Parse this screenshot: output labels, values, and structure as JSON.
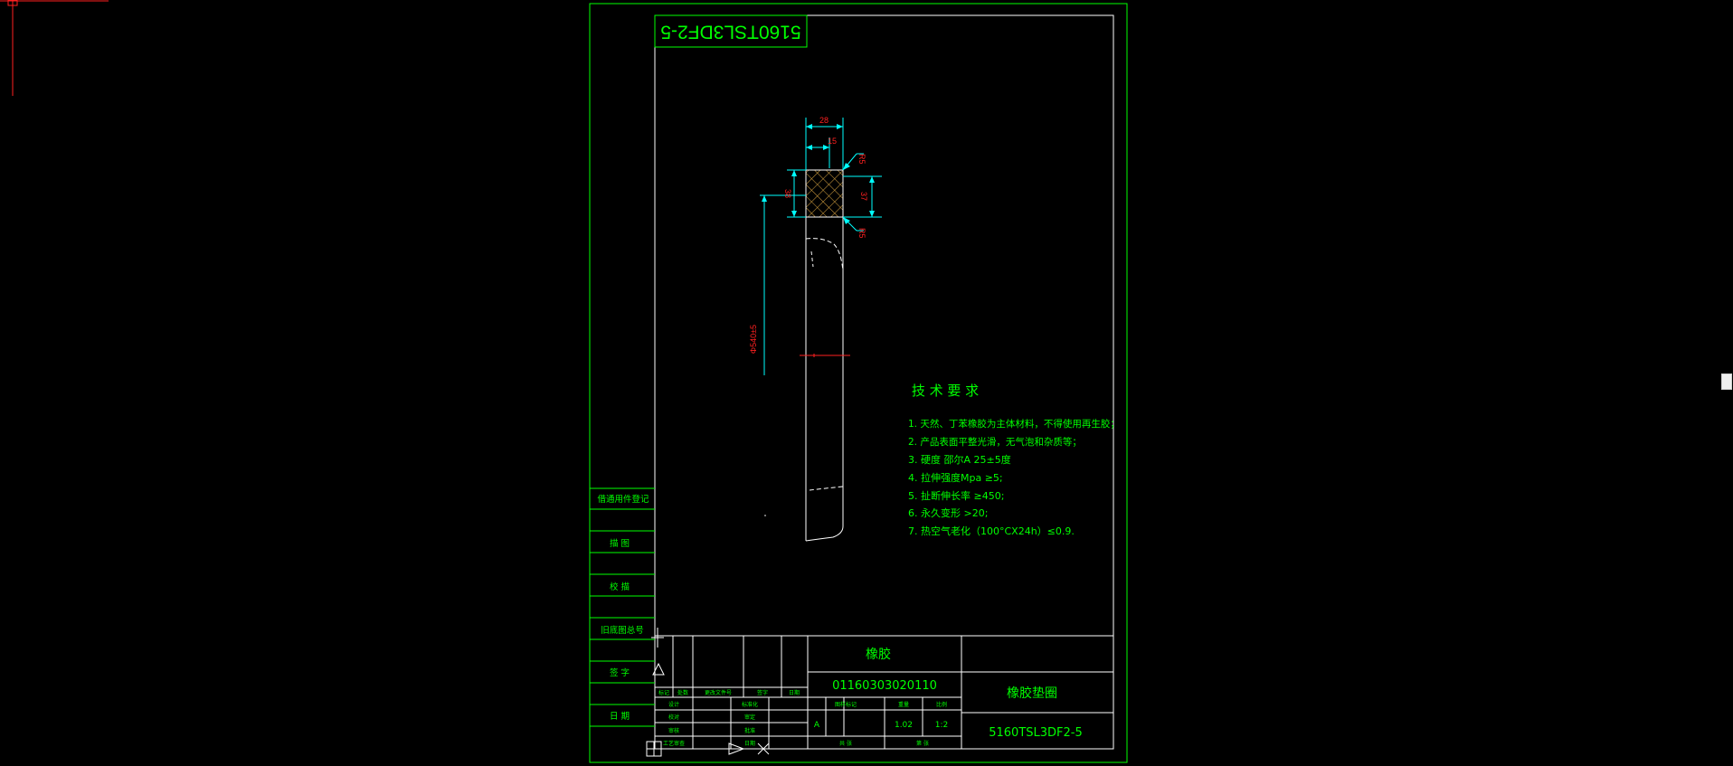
{
  "drawing": {
    "stamp_mirrored": "5160TSL3DF2-5",
    "dimensions": {
      "width_28": "28",
      "width_15": "15",
      "chamfer_top": "R5",
      "chamfer_bottom": "R5",
      "height_37": "37",
      "height_38": "38",
      "diameter": "Φ540±5"
    },
    "tech_req": {
      "title": "技 术 要 求",
      "items": [
        "1. 天然、丁苯橡胶为主体材料，不得使用再生胶；",
        "2. 产品表面平整光滑，无气泡和杂质等；",
        "3. 硬度 邵尔A   25±5度",
        "4. 拉伸强度Mpa     ≥5;",
        "5. 扯断伸长率      ≥450;",
        "6. 永久变形          >20;",
        "7. 热空气老化（100°CX24h）≤0.9."
      ]
    },
    "side_table": [
      "借通用件登记",
      "描  图",
      "校  描",
      "旧底图总号",
      "签  字",
      "日  期"
    ],
    "title_block": {
      "material": "橡胶",
      "code": "01160303020110",
      "part_name": "橡胶垫圈",
      "drawing_no": "5160TSL3DF2-5",
      "rev_hdr": [
        "标记",
        "处数",
        "更改文件号",
        "签字",
        "日期"
      ],
      "staff": [
        [
          "设计",
          "标准化"
        ],
        [
          "校对",
          "审定"
        ],
        [
          "审核",
          "批准"
        ],
        [
          "工艺审查",
          "日期"
        ]
      ],
      "stage_hdr": [
        "图样标记",
        "重量",
        "比例"
      ],
      "stage": "A",
      "weight": "1.02",
      "scale": "1:2",
      "sheet": [
        "共  张",
        "第  张"
      ]
    }
  },
  "colors": {
    "frame": "#00ff00",
    "lines": "#ffffff",
    "dims": "#00ffff",
    "dim_text": "#ff2020",
    "hatch": "#d9a441",
    "text": "#00ff00",
    "background": "#000000"
  }
}
